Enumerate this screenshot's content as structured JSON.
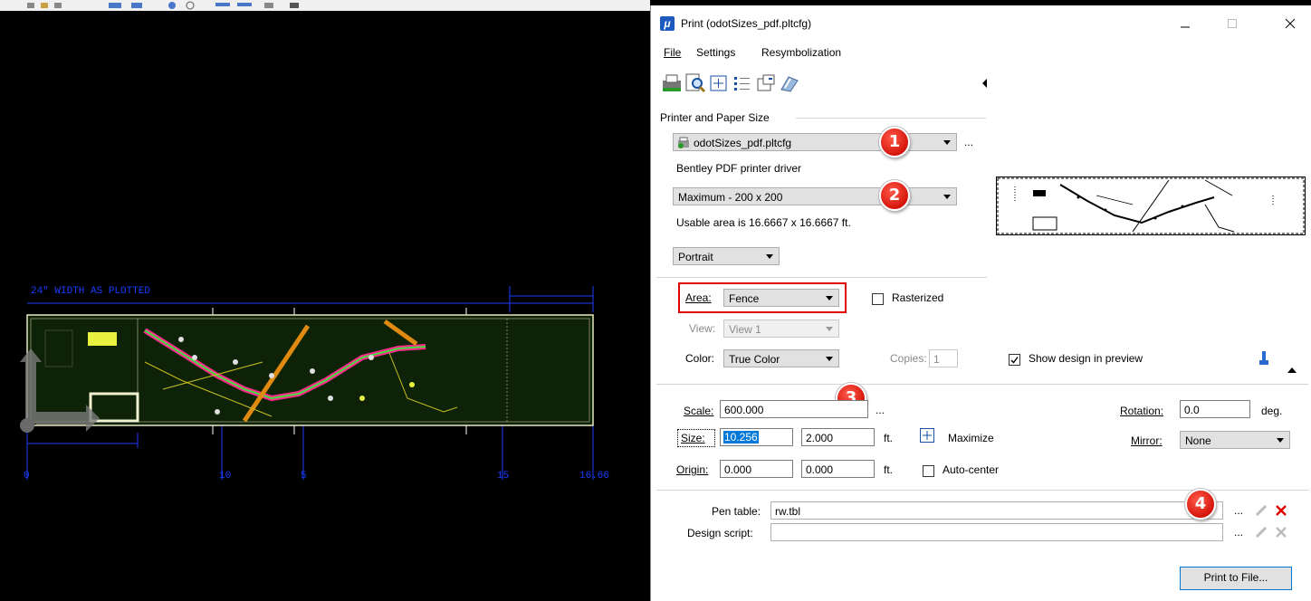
{
  "cad": {
    "width_label": "24\" WIDTH AS PLOTTED",
    "ruler_labels": [
      "0",
      "10",
      "5",
      "15",
      "16.66"
    ]
  },
  "dialog": {
    "title": "Print  (odotSizes_pdf.pltcfg)",
    "menu": [
      "File",
      "Settings",
      "Resymbolization"
    ],
    "toolbar_icons": [
      "printer-icon",
      "preview-icon",
      "fit-view-icon",
      "list-icon",
      "view-window-icon",
      "fence-icon"
    ],
    "printer_section": "Printer and Paper Size",
    "printer_config": "odotSizes_pdf.pltcfg",
    "printer_driver": "Bentley PDF printer driver",
    "paper_size": "Maximum - 200 x 200",
    "usable_area": "Usable area is 16.6667 x 16.6667 ft.",
    "orientation": "Portrait",
    "area_label": "Area:",
    "area_value": "Fence",
    "rasterized_label": "Rasterized",
    "view_label": "View:",
    "view_value": "View 1",
    "color_label": "Color:",
    "color_value": "True Color",
    "copies_label": "Copies:",
    "copies_value": "1",
    "show_design_label": "Show design in preview",
    "scale_label": "Scale:",
    "scale_value": "600.000",
    "ellipsis": "...",
    "rotation_label": "Rotation:",
    "rotation_value": "0.0",
    "rotation_unit": "deg.",
    "size_label": "Size:",
    "size_x": "10.256",
    "size_y": "2.000",
    "unit_ft": "ft.",
    "maximize_label": "Maximize",
    "mirror_label": "Mirror:",
    "mirror_value": "None",
    "origin_label": "Origin:",
    "origin_x": "0.000",
    "origin_y": "0.000",
    "autocenter_label": "Auto-center",
    "pen_table_label": "Pen table:",
    "pen_table_value": "rw.tbl",
    "design_script_label": "Design script:",
    "design_script_value": "",
    "print_button": "Print to File...",
    "callouts": [
      "1",
      "2",
      "3",
      "4"
    ]
  },
  "colors": {
    "cad_background": "#000000",
    "cad_blue": "#1a3dff",
    "callout_red": "#d5150b",
    "highlight_box": "#e00000",
    "dialog_background": "#ffffff"
  }
}
